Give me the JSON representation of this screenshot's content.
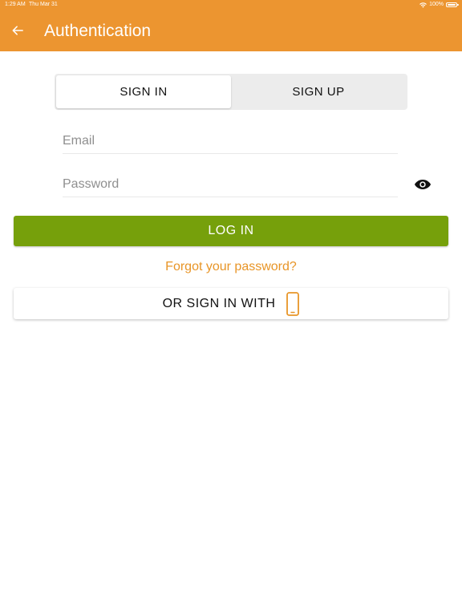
{
  "status_bar": {
    "time": "1:29 AM",
    "date": "Thu Mar 31",
    "battery": "100%"
  },
  "header": {
    "title": "Authentication",
    "back_icon": "arrow-left-icon"
  },
  "tabs": [
    {
      "label": "SIGN IN",
      "active": true
    },
    {
      "label": "SIGN UP",
      "active": false
    }
  ],
  "form": {
    "email_placeholder": "Email",
    "email_value": "",
    "password_placeholder": "Password",
    "password_value": "",
    "visibility_icon": "eye-icon"
  },
  "actions": {
    "login_label": "LOG IN",
    "forgot_label": "Forgot your password?",
    "alt_signin_label": "OR SIGN IN WITH",
    "alt_signin_icon": "smartphone-icon"
  },
  "colors": {
    "brand": "#ec9530",
    "primary_button": "#76a00b",
    "link": "#e89527"
  }
}
